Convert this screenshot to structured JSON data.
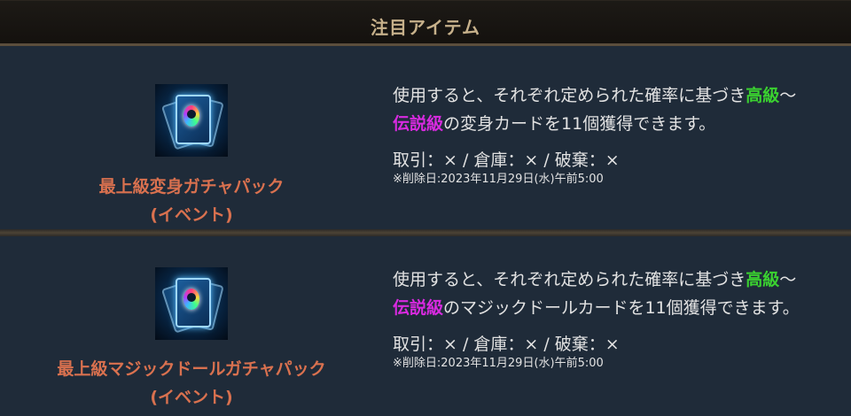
{
  "header": {
    "title": "注目アイテム"
  },
  "colors": {
    "grade_high": "#3ad130",
    "grade_legend": "#d82ae0",
    "item_name": "#d9714f"
  },
  "items": [
    {
      "icon": "transform-card-pack-icon",
      "name_line1": "最上級変身ガチャパック",
      "name_line2": "(イベント)",
      "desc_pre": "使用すると、それぞれ定められた確率に基づき",
      "grade_high": "高級",
      "tilde": "～",
      "grade_legend": "伝説級",
      "desc_post": "の変身カードを11個獲得できます。",
      "trade": "取引：× / 倉庫：× / 破棄：×",
      "delete_date": "※削除日:2023年11月29日(水)午前5:00"
    },
    {
      "icon": "magic-doll-card-pack-icon",
      "name_line1": "最上級マジックドールガチャパック",
      "name_line2": "(イベント)",
      "desc_pre": "使用すると、それぞれ定められた確率に基づき",
      "grade_high": "高級",
      "tilde": "～",
      "grade_legend": "伝説級",
      "desc_post": "のマジックドールカードを11個獲得できます。",
      "trade": "取引：× / 倉庫：× / 破棄：×",
      "delete_date": "※削除日:2023年11月29日(水)午前5:00"
    }
  ]
}
